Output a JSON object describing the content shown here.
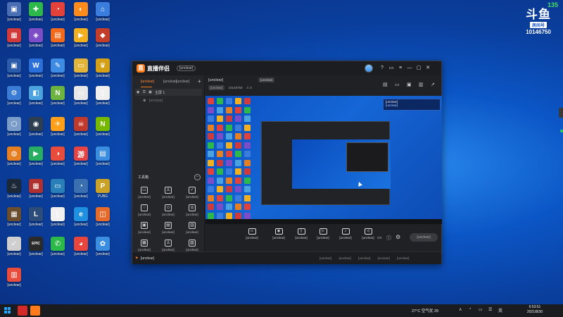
{
  "desktop": {
    "icons": [
      {
        "label": "[unclear]",
        "glyph": "▣",
        "color": "#4a6fb5"
      },
      {
        "label": "[unclear]",
        "glyph": "✚",
        "color": "#2db84a"
      },
      {
        "label": "[unclear]",
        "glyph": "◔",
        "color": "#e2423a"
      },
      {
        "label": "[unclear]",
        "glyph": "◐",
        "color": "#ff8c1a"
      },
      {
        "label": "[unclear]",
        "glyph": "⌂",
        "color": "#3b7ddd"
      },
      {
        "label": "[unclear]",
        "glyph": "▦",
        "color": "#d03a3a"
      },
      {
        "label": "[unclear]",
        "glyph": "◈",
        "color": "#7d4cc7"
      },
      {
        "label": "[unclear]",
        "glyph": "▤",
        "color": "#f26b1d"
      },
      {
        "label": "[unclear]",
        "glyph": "▶",
        "color": "#f2b01e"
      },
      {
        "label": "[unclear]",
        "glyph": "◆",
        "color": "#c23e2b"
      },
      {
        "label": "[unclear]",
        "glyph": "▣",
        "color": "#2a5caa"
      },
      {
        "label": "[unclear]",
        "glyph": "W",
        "color": "#2b6fd8"
      },
      {
        "label": "[unclear]",
        "glyph": "✎",
        "color": "#3d8be3"
      },
      {
        "label": "[unclear]",
        "glyph": "▭",
        "color": "#e3b43a"
      },
      {
        "label": "[unclear]",
        "glyph": "♛",
        "color": "#d4a017"
      },
      {
        "label": "[unclear]",
        "glyph": "⚙",
        "color": "#3a7bd5"
      },
      {
        "label": "[unclear]",
        "glyph": "◧",
        "color": "#4aa3df"
      },
      {
        "label": "[unclear]",
        "glyph": "N",
        "color": "#6cb33f"
      },
      {
        "label": "[unclear]",
        "glyph": "▭",
        "color": "#e8e8e8"
      },
      {
        "label": "[unclear]",
        "glyph": "▯",
        "color": "#f0f0f0"
      },
      {
        "label": "[unclear]",
        "glyph": "⬡",
        "color": "#7a9cc9"
      },
      {
        "label": "[unclear]",
        "glyph": "◉",
        "color": "#2c3e50"
      },
      {
        "label": "[unclear]",
        "glyph": "✈",
        "color": "#ff9f1a"
      },
      {
        "label": "[unclear]",
        "glyph": "☠",
        "color": "#c0392b"
      },
      {
        "label": "[unclear]",
        "glyph": "N",
        "color": "#76b900"
      },
      {
        "label": "[unclear]",
        "glyph": "◍",
        "color": "#e67e22"
      },
      {
        "label": "[unclear]",
        "glyph": "▶",
        "color": "#27ae60"
      },
      {
        "label": "[unclear]",
        "glyph": "◑",
        "color": "#e74c3c"
      },
      {
        "label": "[unclear]",
        "glyph": "游",
        "color": "#e84343"
      },
      {
        "label": "[unclear]",
        "glyph": "▤",
        "color": "#3b8de0"
      },
      {
        "label": "[unclear]",
        "glyph": "♨",
        "color": "#1b2838"
      },
      {
        "label": "[unclear]",
        "glyph": "▦",
        "color": "#b03030"
      },
      {
        "label": "[unclear]",
        "glyph": "▭",
        "color": "#2980b9"
      },
      {
        "label": "[unclear]",
        "glyph": "◔",
        "color": "#3a6fb0"
      },
      {
        "label": "PUBG",
        "glyph": "P",
        "color": "#c9a227"
      },
      {
        "label": "[unclear]",
        "glyph": "▦",
        "color": "#6b4e2e"
      },
      {
        "label": "[unclear]",
        "glyph": "L",
        "color": "#2c4c7a"
      },
      {
        "label": "[unclear]",
        "glyph": "▯",
        "color": "#f0f0f0"
      },
      {
        "label": "[unclear]",
        "glyph": "e",
        "color": "#1f8fe0"
      },
      {
        "label": "[unclear]",
        "glyph": "◫",
        "color": "#e66b2a"
      },
      {
        "label": "[unclear]",
        "glyph": "✓",
        "color": "#cfcfcf"
      },
      {
        "label": "[unclear]",
        "glyph": "EPIC",
        "color": "#2a2a2a"
      },
      {
        "label": "[unclear]",
        "glyph": "✆",
        "color": "#2db84a"
      },
      {
        "label": "[unclear]",
        "glyph": "◕",
        "color": "#e8453c"
      },
      {
        "label": "[unclear]",
        "glyph": "✿",
        "color": "#3b8de0"
      },
      {
        "label": "[unclear]",
        "glyph": "▥",
        "color": "#e74c3c"
      }
    ]
  },
  "watermark": {
    "fps": "135",
    "brand": "斗鱼",
    "badge": "房间号",
    "room_id": "10146750"
  },
  "app": {
    "title": "直播伴侣",
    "version_chip": "[unclear]",
    "window_buttons": [
      "?",
      "▭",
      "≡",
      "—",
      "▢",
      "✕"
    ],
    "sidebar": {
      "tabs": [
        "[unclear]",
        "[unclear]",
        "[unclear]"
      ],
      "add": "+",
      "scenes": [
        {
          "label": "主屏 1"
        },
        {
          "label": "[unclear]"
        }
      ],
      "tools_header": "工具箱",
      "tools_collapse": "−",
      "tools": [
        {
          "icon": "▭",
          "label": "[unclear]"
        },
        {
          "icon": "♙",
          "label": "[unclear]"
        },
        {
          "icon": "✓",
          "label": "[unclear]"
        },
        {
          "icon": "♡",
          "label": "[unclear]"
        },
        {
          "icon": "◇",
          "label": "[unclear]"
        },
        {
          "icon": "◎",
          "label": "[unclear]"
        },
        {
          "icon": "▣",
          "label": "[unclear]"
        },
        {
          "icon": "▤",
          "label": "[unclear]"
        },
        {
          "icon": "▥",
          "label": "[unclear]"
        },
        {
          "icon": "▦",
          "label": "[unclear]"
        },
        {
          "icon": "♙",
          "label": "[unclear]"
        },
        {
          "icon": "▧",
          "label": "[unclear]"
        }
      ]
    },
    "stream": {
      "title": "[unclear]",
      "edit": "[unclear]",
      "room_chip": "[unclear]",
      "room_id": "10146750",
      "likes": "0"
    },
    "top_icons": [
      "▤",
      "▭",
      "▣",
      "▥",
      "↗"
    ],
    "preview": {
      "toast_line1": "[unclear]",
      "toast_line2": "[unclear]"
    },
    "controls": [
      {
        "icon": "▭",
        "label": "[unclear]"
      },
      {
        "icon": "◉",
        "label": "[unclear]"
      },
      {
        "icon": "▯",
        "label": "[unclear]"
      },
      {
        "icon": "▷",
        "label": "[unclear]"
      },
      {
        "icon": "♪",
        "label": "[unclear]"
      },
      {
        "icon": "◁",
        "label": "[unclear]"
      }
    ],
    "go_live": "[unclear]",
    "status_flag": "⚑",
    "status_text": "[unclear]",
    "stats": [
      "[unclear]",
      "[unclear]",
      "[unclear]",
      "[unclear]",
      "[unclear]"
    ]
  },
  "taskbar": {
    "weather": "27°C 空气优 29",
    "time": "6:53:51",
    "date": "2021/8/30",
    "tray_icons": [
      "∧",
      "◔",
      "▭",
      "☰",
      "英"
    ],
    "app_colors": [
      "#d42a2a",
      "#ff7a1a"
    ]
  }
}
